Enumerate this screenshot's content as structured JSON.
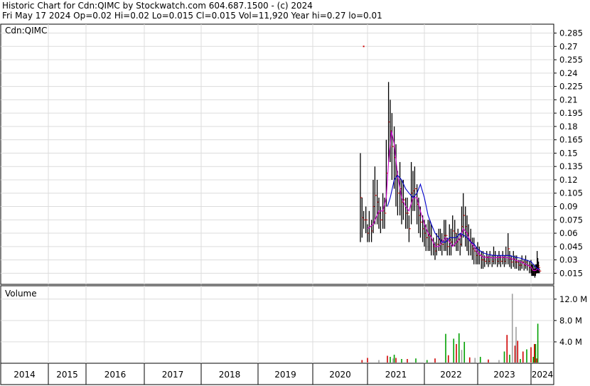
{
  "header": {
    "line1": "Historic Chart for Cdn:QIMC by Stockwatch.com 604.687.1500 - (c) 2024",
    "line2": "Fri May 17 2024   Op=0.02  Hi=0.02  Lo=0.015  Cl=0.015  Vol=11,920  Year hi=0.27  lo=0.01"
  },
  "chart_data": [
    {
      "type": "line",
      "panel": "price",
      "title": "Cdn:QIMC",
      "ylim": [
        0.0025,
        0.295
      ],
      "y_ticks": [
        "0.285",
        "0.27",
        "0.255",
        "0.24",
        "0.225",
        "0.21",
        "0.195",
        "0.18",
        "0.165",
        "0.15",
        "0.135",
        "0.12",
        "0.105",
        "0.09",
        "0.075",
        "0.06",
        "0.045",
        "0.03",
        "0.015"
      ],
      "x_year_labels": [
        "2014",
        "2015",
        "2016",
        "2017",
        "2018",
        "2019",
        "2020",
        "2021",
        "2022",
        "2023",
        "2024"
      ],
      "outlier_point": {
        "x": 2020.93,
        "y": 0.27
      },
      "series": [
        {
          "kind": "price-bars",
          "x": [
            2020.87,
            2020.9,
            2020.93,
            2020.97,
            2021.0,
            2021.03,
            2021.07,
            2021.1,
            2021.13,
            2021.17,
            2021.2,
            2021.23,
            2021.27,
            2021.3,
            2021.33,
            2021.37,
            2021.4,
            2021.43,
            2021.47,
            2021.5,
            2021.53,
            2021.57,
            2021.6,
            2021.63,
            2021.67,
            2021.7,
            2021.73,
            2021.77,
            2021.8,
            2021.83,
            2021.87,
            2021.9,
            2021.93,
            2021.97,
            2022.0,
            2022.03,
            2022.07,
            2022.1,
            2022.13,
            2022.17,
            2022.2,
            2022.23,
            2022.27,
            2022.3,
            2022.33,
            2022.37,
            2022.4,
            2022.43,
            2022.47,
            2022.5,
            2022.53,
            2022.57,
            2022.6,
            2022.63,
            2022.67,
            2022.7,
            2022.73,
            2022.77,
            2022.8,
            2022.83,
            2022.87,
            2022.9,
            2022.93,
            2022.97,
            2023.0,
            2023.03,
            2023.07,
            2023.1,
            2023.13,
            2023.17,
            2023.2,
            2023.23,
            2023.27,
            2023.3,
            2023.33,
            2023.37,
            2023.4,
            2023.43,
            2023.47,
            2023.5,
            2023.53,
            2023.57,
            2023.6,
            2023.63,
            2023.67,
            2023.7,
            2023.73,
            2023.77,
            2023.8,
            2023.83,
            2023.87,
            2023.9,
            2023.93,
            2023.97,
            2024.0,
            2024.03,
            2024.07,
            2024.1,
            2024.13,
            2024.17,
            2024.2,
            2024.23,
            2024.27,
            2024.3,
            2024.33,
            2024.37
          ],
          "high": [
            0.15,
            0.1,
            0.085,
            0.09,
            0.07,
            0.085,
            0.075,
            0.12,
            0.135,
            0.12,
            0.1,
            0.09,
            0.105,
            0.1,
            0.165,
            0.23,
            0.21,
            0.195,
            0.18,
            0.16,
            0.13,
            0.14,
            0.12,
            0.12,
            0.1,
            0.1,
            0.08,
            0.14,
            0.13,
            0.135,
            0.115,
            0.1,
            0.09,
            0.08,
            0.075,
            0.07,
            0.075,
            0.075,
            0.07,
            0.055,
            0.05,
            0.06,
            0.065,
            0.065,
            0.06,
            0.075,
            0.075,
            0.055,
            0.07,
            0.065,
            0.08,
            0.075,
            0.06,
            0.065,
            0.06,
            0.09,
            0.105,
            0.09,
            0.08,
            0.07,
            0.065,
            0.055,
            0.055,
            0.045,
            0.05,
            0.045,
            0.04,
            0.04,
            0.035,
            0.04,
            0.035,
            0.04,
            0.035,
            0.045,
            0.04,
            0.035,
            0.04,
            0.035,
            0.04,
            0.035,
            0.045,
            0.06,
            0.04,
            0.035,
            0.04,
            0.035,
            0.035,
            0.03,
            0.03,
            0.035,
            0.03,
            0.035,
            0.03,
            0.028,
            0.03,
            0.025,
            0.025,
            0.02,
            0.025,
            0.02,
            0.025,
            0.025,
            0.04,
            0.032,
            0.028,
            0.02
          ],
          "low": [
            0.05,
            0.055,
            0.065,
            0.06,
            0.05,
            0.05,
            0.05,
            0.06,
            0.07,
            0.07,
            0.065,
            0.06,
            0.065,
            0.065,
            0.09,
            0.14,
            0.14,
            0.12,
            0.11,
            0.09,
            0.08,
            0.08,
            0.07,
            0.075,
            0.065,
            0.065,
            0.05,
            0.07,
            0.085,
            0.085,
            0.07,
            0.06,
            0.055,
            0.05,
            0.045,
            0.04,
            0.04,
            0.04,
            0.035,
            0.035,
            0.03,
            0.035,
            0.04,
            0.04,
            0.035,
            0.04,
            0.04,
            0.035,
            0.035,
            0.035,
            0.045,
            0.045,
            0.04,
            0.04,
            0.035,
            0.045,
            0.055,
            0.045,
            0.04,
            0.035,
            0.035,
            0.03,
            0.025,
            0.025,
            0.025,
            0.025,
            0.02,
            0.02,
            0.022,
            0.025,
            0.022,
            0.025,
            0.022,
            0.025,
            0.025,
            0.022,
            0.025,
            0.022,
            0.025,
            0.022,
            0.025,
            0.025,
            0.022,
            0.02,
            0.022,
            0.02,
            0.02,
            0.018,
            0.018,
            0.02,
            0.018,
            0.02,
            0.018,
            0.015,
            0.015,
            0.012,
            0.012,
            0.012,
            0.012,
            0.01,
            0.012,
            0.015,
            0.015,
            0.015,
            0.015,
            0.015
          ]
        },
        {
          "kind": "moving-average-fast",
          "color": "#d000d0",
          "x": [
            2021.0,
            2021.1,
            2021.2,
            2021.27,
            2021.33,
            2021.37,
            2021.42,
            2021.47,
            2021.53,
            2021.6,
            2021.67,
            2021.73,
            2021.8,
            2021.87,
            2021.93,
            2022.0,
            2022.07,
            2022.13,
            2022.2,
            2022.27,
            2022.33,
            2022.4,
            2022.47,
            2022.53,
            2022.6,
            2022.67,
            2022.73,
            2022.8,
            2022.87,
            2022.93,
            2023.0,
            2023.1,
            2023.2,
            2023.3,
            2023.4,
            2023.5,
            2023.6,
            2023.7,
            2023.8,
            2023.9,
            2024.0,
            2024.1,
            2024.2,
            2024.3,
            2024.37
          ],
          "y": [
            0.065,
            0.07,
            0.085,
            0.085,
            0.1,
            0.14,
            0.175,
            0.16,
            0.125,
            0.1,
            0.09,
            0.085,
            0.1,
            0.1,
            0.085,
            0.07,
            0.06,
            0.055,
            0.045,
            0.045,
            0.05,
            0.055,
            0.05,
            0.045,
            0.05,
            0.055,
            0.065,
            0.06,
            0.05,
            0.045,
            0.038,
            0.033,
            0.033,
            0.032,
            0.033,
            0.033,
            0.032,
            0.03,
            0.028,
            0.025,
            0.022,
            0.018,
            0.018,
            0.02,
            0.018
          ]
        },
        {
          "kind": "moving-average-slow",
          "color": "#0000cc",
          "x": [
            2021.35,
            2021.4,
            2021.47,
            2021.53,
            2021.6,
            2021.67,
            2021.73,
            2021.8,
            2021.87,
            2021.93,
            2022.0,
            2022.07,
            2022.13,
            2022.2,
            2022.27,
            2022.33,
            2022.4,
            2022.47,
            2022.53,
            2022.6,
            2022.67,
            2022.73,
            2022.8,
            2022.87,
            2022.93,
            2023.0,
            2023.1,
            2023.2,
            2023.3,
            2023.4,
            2023.5,
            2023.6,
            2023.7,
            2023.8,
            2023.9,
            2024.0,
            2024.1,
            2024.2,
            2024.3,
            2024.37
          ],
          "y": [
            0.09,
            0.1,
            0.12,
            0.125,
            0.12,
            0.11,
            0.105,
            0.1,
            0.105,
            0.115,
            0.1,
            0.08,
            0.07,
            0.06,
            0.055,
            0.05,
            0.05,
            0.055,
            0.055,
            0.055,
            0.06,
            0.058,
            0.055,
            0.05,
            0.048,
            0.042,
            0.038,
            0.036,
            0.035,
            0.035,
            0.035,
            0.035,
            0.033,
            0.032,
            0.03,
            0.028,
            0.025,
            0.022,
            0.02,
            0.02
          ]
        }
      ]
    },
    {
      "type": "bar",
      "panel": "volume",
      "title": "Volume",
      "ylim": [
        0,
        14.5
      ],
      "y_unit": "M",
      "y_ticks": [
        "12.0 M",
        "8.0 M",
        "4.0 M"
      ],
      "series": [
        {
          "name": "up-volume",
          "color": "#00a000",
          "x": [
            2021.4,
            2021.47,
            2021.6,
            2021.85,
            2022.05,
            2022.4,
            2022.55,
            2022.65,
            2022.75,
            2023.05,
            2023.5,
            2023.6,
            2023.8,
            2023.92,
            2024.1,
            2024.2,
            2024.3
          ],
          "values": [
            1.2,
            1.6,
            0.8,
            0.9,
            0.6,
            5.5,
            4.6,
            5.6,
            4.0,
            1.2,
            2.2,
            1.6,
            0.8,
            2.6,
            1.2,
            3.6,
            7.4
          ]
        },
        {
          "name": "down-volume",
          "color": "#d00000",
          "x": [
            2020.9,
            2021.0,
            2021.35,
            2021.5,
            2021.7,
            2022.2,
            2022.45,
            2022.6,
            2022.85,
            2023.2,
            2023.55,
            2023.7,
            2023.75,
            2023.85,
            2024.0,
            2024.15,
            2024.25
          ],
          "values": [
            0.6,
            1.0,
            1.4,
            1.0,
            0.8,
            0.9,
            1.5,
            3.6,
            1.1,
            0.7,
            5.3,
            3.3,
            4.2,
            2.2,
            3.0,
            3.6,
            0.9
          ]
        },
        {
          "name": "unchanged-volume",
          "color": "#a0a0a0",
          "x": [
            2021.2,
            2021.45,
            2022.7,
            2022.95,
            2023.4,
            2023.65,
            2023.72
          ],
          "values": [
            0.6,
            0.9,
            2.5,
            1.0,
            0.6,
            13.0,
            6.8
          ]
        }
      ]
    }
  ]
}
